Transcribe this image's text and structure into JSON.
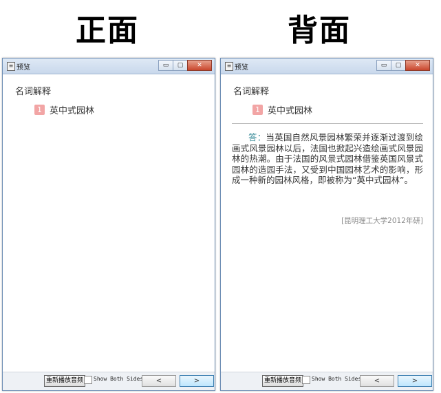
{
  "front_label": "正面",
  "back_label": "背面",
  "window": {
    "title": "预览",
    "app_icon": "preview-app-icon",
    "minimize_glyph": "▭",
    "maximize_glyph": "▢",
    "close_glyph": "✕"
  },
  "card": {
    "heading": "名词解释",
    "item_number": "1",
    "item_label": "英中式园林",
    "answer_prefix": "答：",
    "answer_text": "当英国自然风景园林繁荣并逐渐过渡到绘画式风景园林以后，法国也掀起兴造绘画式风景园林的热潮。由于法国的风景式园林借鉴英国风景式园林的造园手法，又受到中国园林艺术的影响，形成一种新的园林风格，即被称为“英中式园林”。",
    "source": "[昆明理工大学2012年研]"
  },
  "bottombar": {
    "replay_label": "重新播放音频",
    "show_both_label": "Show Both Sides",
    "prev_glyph": "<",
    "next_glyph": ">"
  },
  "colors": {
    "badge": "#f2a5a5",
    "answer_prefix": "#3b8d9a",
    "close_button": "#c9462d"
  }
}
